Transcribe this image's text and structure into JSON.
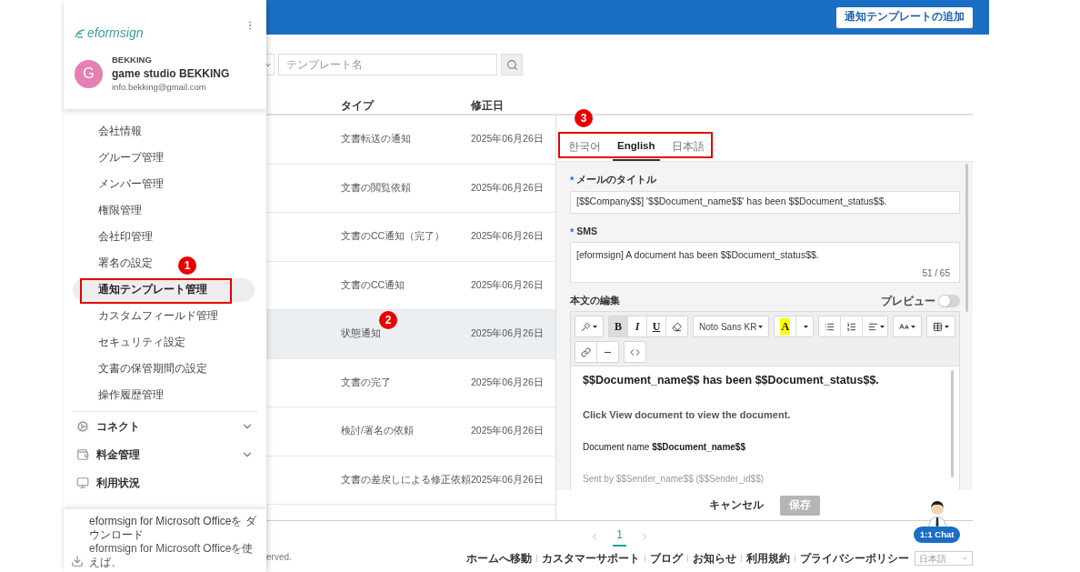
{
  "sidebar": {
    "logo": "eformsign",
    "avatar_letter": "G",
    "company": "BEKKING",
    "name": "game studio BEKKING",
    "email": "info.bekking@gmail.com",
    "items": [
      {
        "label": "会社情報",
        "selected": false
      },
      {
        "label": "グループ管理",
        "selected": false
      },
      {
        "label": "メンバー管理",
        "selected": false
      },
      {
        "label": "権限管理",
        "selected": false
      },
      {
        "label": "会社印管理",
        "selected": false
      },
      {
        "label": "署名の設定",
        "selected": false
      },
      {
        "label": "通知テンプレート管理",
        "selected": true,
        "callout": "1"
      },
      {
        "label": "カスタムフィールド管理",
        "selected": false
      },
      {
        "label": "セキュリティ設定",
        "selected": false
      },
      {
        "label": "文書の保管期間の設定",
        "selected": false
      },
      {
        "label": "操作履歴管理",
        "selected": false
      }
    ],
    "sections": [
      {
        "label": "コネクト",
        "expanded": false
      },
      {
        "label": "料金管理",
        "expanded": false
      },
      {
        "label": "利用状況"
      }
    ],
    "download": {
      "title": "eformsign for Microsoft Officeを ダウンロード",
      "text": "eformsign for Microsoft Officeを使えば、"
    }
  },
  "header": {
    "add_button": "通知テンプレートの追加"
  },
  "search": {
    "placeholder": "テンプレート名"
  },
  "table": {
    "columns": [
      "タイプ",
      "修正日"
    ],
    "rows": [
      {
        "type": "文書転送の通知",
        "date": "2025年06月26日",
        "selected": false
      },
      {
        "type": "文書の閲覧依頼",
        "date": "2025年06月26日",
        "selected": false
      },
      {
        "type": "文書のCC通知（完了）",
        "date": "2025年06月26日",
        "selected": false
      },
      {
        "type": "文書のCC通知",
        "date": "2025年06月26日",
        "selected": false
      },
      {
        "type": "状態通知",
        "date": "2025年06月26日",
        "selected": true,
        "callout": "2"
      },
      {
        "type": "文書の完了",
        "date": "2025年06月26日",
        "selected": false
      },
      {
        "type": "検討/署名の依頼",
        "date": "2025年06月26日",
        "selected": false
      },
      {
        "type": "文書の差戻しによる修正依頼",
        "date": "2025年06月26日",
        "selected": false
      }
    ]
  },
  "editor": {
    "tabs_callout": "3",
    "tabs": [
      {
        "label": "한국어",
        "selected": false
      },
      {
        "label": "English",
        "selected": true
      },
      {
        "label": "日本語",
        "selected": false
      }
    ],
    "title_field": {
      "mark": "*",
      "label": "メールのタイトル",
      "value": "[$$Company$$] '$$Document_name$$' has been $$Document_status$$."
    },
    "sms_field": {
      "mark": "*",
      "label": "SMS",
      "value": "[eformsign] A document has been $$Document_status$$.",
      "count": "51 / 65"
    },
    "body_label": "本文の編集",
    "preview": {
      "label": "プレビュー",
      "on": false
    },
    "format_buttons": [
      {
        "label": "B",
        "selected": true
      },
      {
        "label": "I",
        "selected": false
      },
      {
        "label": "U",
        "selected": false
      }
    ],
    "font_select": "Noto Sans KR",
    "highlight_button": "A",
    "body": [
      {
        "kind": "heading",
        "text": "$$Document_name$$ has been $$Document_status$$."
      },
      {
        "kind": "paragraph",
        "text": "Click **View document** to view the document."
      },
      {
        "kind": "meta",
        "text": "Document name **$$Document_name$$**"
      },
      {
        "kind": "note",
        "text": "Sent by $$Sender_name$$ ($$Sender_id$$)"
      }
    ],
    "cancel_button": "キャンセル",
    "save_button": {
      "label": "保存",
      "disabled": true
    }
  },
  "footer": {
    "copyright": "erved.",
    "pages": [
      {
        "label": "1",
        "selected": true
      }
    ],
    "links": [
      "ホームへ移動",
      "カスタマーサポート",
      "ブログ",
      "お知らせ",
      "利用規約",
      "プライバシーポリシー"
    ],
    "language": "日本語",
    "chat": "1:1 Chat"
  }
}
